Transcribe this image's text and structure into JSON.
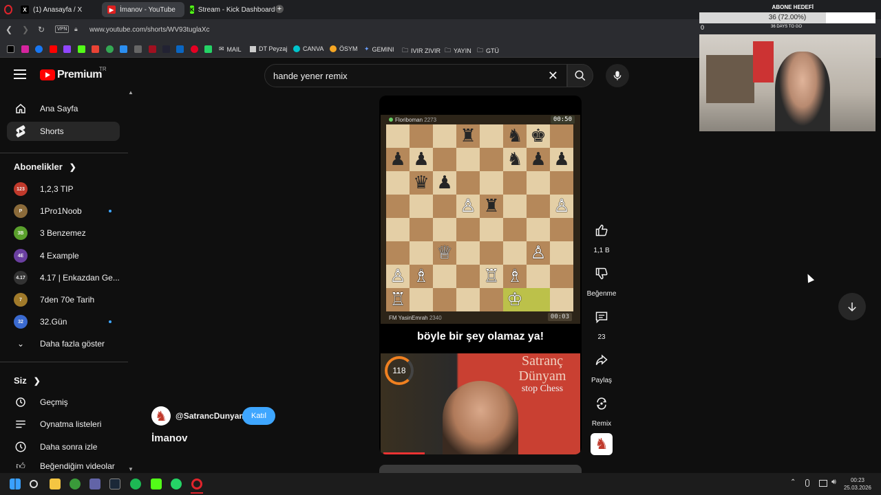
{
  "browser": {
    "tabs": [
      {
        "label": "(1) Anasayfa / X",
        "icon": "x-icon"
      },
      {
        "label": "İmanov - YouTube",
        "icon": "youtube-icon"
      },
      {
        "label": "Stream - Kick Dashboard",
        "icon": "kick-icon"
      }
    ],
    "vpn_label": "VPN",
    "url": "www.youtube.com/shorts/WV93tuglaXc",
    "bookmarks": [
      "MAIL",
      "DT Peyzaj",
      "CANVA",
      "ÖSYM",
      "GEMINI",
      "IVIR ZIVIR",
      "YAYIN",
      "GTÜ"
    ]
  },
  "youtube": {
    "brand": "Premium",
    "country": "TR",
    "nav": [
      {
        "label": "Ana Sayfa",
        "icon": "home-icon"
      },
      {
        "label": "Shorts",
        "icon": "shorts-icon"
      }
    ],
    "subscriptions_header": "Abonelikler",
    "subscriptions": [
      {
        "label": "1,2,3 TIP",
        "color": "#c0392b",
        "badge": "123"
      },
      {
        "label": "1Pro1Noob",
        "color": "#8b6b3a",
        "badge": "P",
        "new": true
      },
      {
        "label": "3 Benzemez",
        "color": "#5aa02c",
        "badge": "3B"
      },
      {
        "label": "4 Example",
        "color": "#6a3fa0",
        "badge": "4E"
      },
      {
        "label": "4.17 | Enkazdan Ge...",
        "color": "#333333",
        "badge": "4.17"
      },
      {
        "label": "7den 70e Tarih",
        "color": "#a07a2a",
        "badge": "7"
      },
      {
        "label": "32.Gün",
        "color": "#3a6ad0",
        "badge": "32",
        "new": true
      }
    ],
    "show_more": "Daha fazla göster",
    "you_header": "Siz",
    "you_items": [
      {
        "label": "Geçmiş",
        "icon": "history-icon"
      },
      {
        "label": "Oynatma listeleri",
        "icon": "playlist-icon"
      },
      {
        "label": "Daha sonra izle",
        "icon": "clock-icon"
      },
      {
        "label": "Beğendiğim videolar",
        "icon": "like-icon"
      }
    ],
    "search": {
      "value": "hande yener remix"
    }
  },
  "short": {
    "top_player": {
      "name": "Floriboman",
      "rating": "2273",
      "clock": "00:50"
    },
    "bottom_player": {
      "name": "FM YasinEmrah",
      "rating": "2340",
      "clock": "00:03"
    },
    "board": [
      [
        "",
        "",
        "",
        "r",
        "",
        "n",
        "k",
        ""
      ],
      [
        "p",
        "p",
        "",
        "",
        "",
        "n",
        "p",
        "p"
      ],
      [
        "",
        "q",
        "p",
        "",
        "",
        "",
        "",
        ""
      ],
      [
        "",
        "",
        "",
        "P",
        "r",
        "",
        "",
        "P"
      ],
      [
        "",
        "",
        "",
        "",
        "",
        "",
        "",
        ""
      ],
      [
        "",
        "",
        "Q",
        "",
        "",
        "",
        "P",
        ""
      ],
      [
        "P",
        "B",
        "",
        "",
        "R",
        "B",
        "",
        ""
      ],
      [
        "R",
        "",
        "",
        "",
        "",
        "K",
        "",
        ""
      ]
    ],
    "caption": "böyle bir şey olamaz ya!",
    "overlay_counter": "118",
    "overlay_text_1": "Satranç",
    "overlay_text_2": "Dünyam",
    "overlay_text_3": "stop Chess",
    "channel": "@SatrancDunyam",
    "join_label": "Katıl",
    "title": "İmanov",
    "actions": [
      {
        "label": "1,1 B",
        "icon": "thumbs-up-icon"
      },
      {
        "label": "Beğenme",
        "icon": "thumbs-down-icon"
      },
      {
        "label": "23",
        "icon": "comment-icon"
      },
      {
        "label": "Paylaş",
        "icon": "share-icon"
      },
      {
        "label": "Remix",
        "icon": "remix-icon"
      }
    ]
  },
  "stream_overlay": {
    "goal_label": "ABONE HEDEFİ",
    "goal_text": "36 (72.00%)",
    "goal_fraction": 0.72,
    "goal_start": "0",
    "days_to_go": "36 DAYS TO GO"
  },
  "taskbar": {
    "time": "00:23",
    "date": "25.03.2026"
  }
}
